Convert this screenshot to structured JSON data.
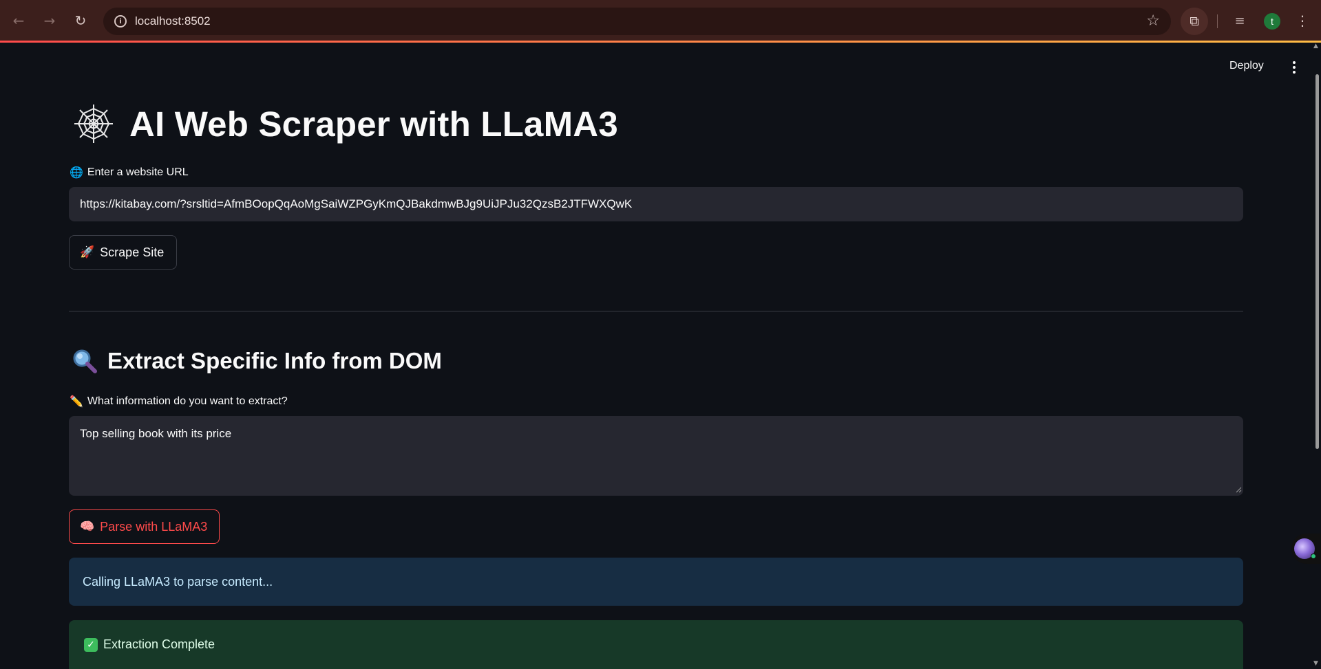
{
  "browser": {
    "url": "localhost:8502",
    "back_icon": "←",
    "forward_icon": "→",
    "reload_icon": "↻",
    "info_icon": "i",
    "star_icon": "☆",
    "extensions_icon": "⧉",
    "media_icon": "≡",
    "profile_initial": "t",
    "menu_icon": "⋮"
  },
  "app_header": {
    "deploy_label": "Deploy"
  },
  "main": {
    "title": "AI Web Scraper with LLaMA3",
    "url_label_emoji": "🌐",
    "url_label": "Enter a website URL",
    "url_value": "https://kitabay.com/?srsltid=AfmBOopQqAoMgSaiWZPGyKmQJBakdmwBJg9UiJPJu32QzsB2JTFWXQwK",
    "scrape_button_emoji": "🚀",
    "scrape_button_label": "Scrape Site",
    "section_title": "Extract Specific Info from DOM",
    "extract_label_emoji": "✏️",
    "extract_label": "What information do you want to extract?",
    "extract_value": "Top selling book with its price",
    "parse_button_emoji": "🧠",
    "parse_button_label": "Parse with LLaMA3",
    "info_message": "Calling LLaMA3 to parse content...",
    "success_message": "Extraction Complete",
    "success_check": "✓"
  },
  "colors": {
    "background": "#0e1117",
    "input_bg": "#262730",
    "accent_red": "#ff4b4b",
    "info_bg": "#172d43",
    "success_bg": "#173928"
  }
}
